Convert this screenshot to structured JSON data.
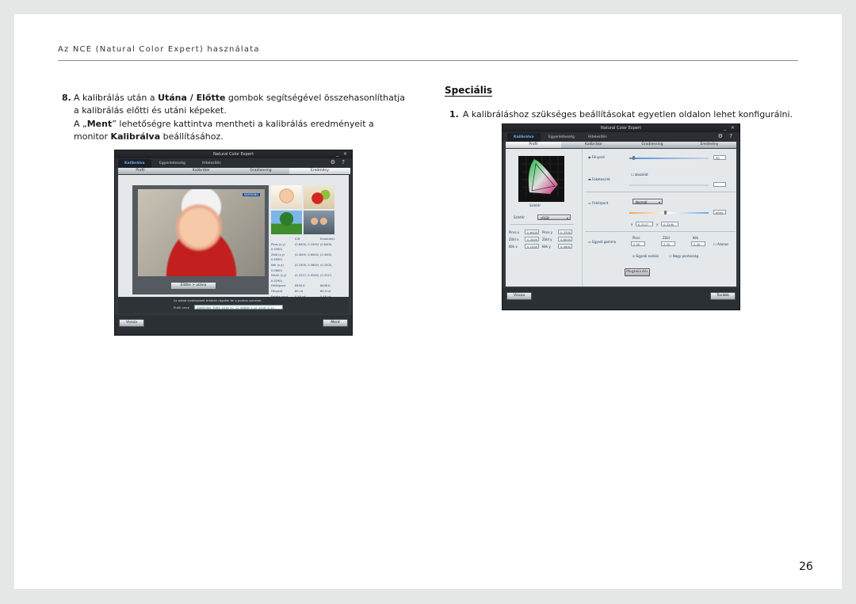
{
  "header": {
    "running_head": "Az NCE (Natural Color Expert) használata",
    "page_number": "26"
  },
  "step8": {
    "number": "8.",
    "p1_a": "A kalibrálás után a ",
    "p1_b": "Utána / Előtte",
    "p1_c": " gombok segítségével összehasonlíthatja a kalibrálás előtti és utáni képeket.",
    "p2_a": "A „",
    "p2_b": "Ment",
    "p2_c": "” lehetőségre kattintva mentheti a kalibrálás eredményeit a monitor ",
    "p2_d": "Kalibrálva",
    "p2_e": " beállításához."
  },
  "special": {
    "title": "Speciális",
    "step_number": "1.",
    "step_text": "A kalibráláshoz szükséges beállításokat egyetlen oldalon lehet konfigurálni."
  },
  "left_window": {
    "title": "Natural Color Expert",
    "controls": "_ ×",
    "tabs": [
      "Kalibrálva",
      "Egyenletesség",
      "Hitelesítés"
    ],
    "toolicons": "⚙ ?",
    "steps": [
      "Profil",
      "Kalibrátor",
      "Gradiensing",
      "Eredmény"
    ],
    "brand": "SAMSUNG",
    "toggle_btn": "Előtte  >  utána",
    "stats_header": [
      "ICB",
      "Eredmény"
    ],
    "stats_rows": [
      [
        "Piros (x,y)",
        "(0.6400, 0.3300)",
        "(0.6400, 0.3300)"
      ],
      [
        "Zöld (x,y)",
        "(0.3000, 0.6000)",
        "(0.3000, 0.6000)"
      ],
      [
        "Kék (x,y)",
        "(0.1500, 0.0600)",
        "(0.1500, 0.0600)"
      ],
      [
        "Fehér (x,y)",
        "(0.3127, 0.3290)",
        "(0.3127, 0.3290)"
      ],
      [
        "Fehérpont",
        "6504 K",
        "6498 K"
      ],
      [
        "Fényerő",
        "80 cd",
        "80.0 cd"
      ],
      [
        "Fekete pont",
        "0.50 cd",
        "0.48 cd"
      ],
      [
        "Értékek gamma",
        "2.20",
        "2.20"
      ]
    ],
    "notice": "Az alább kiválasztott értékek rögzítik fel a pontos színeket.",
    "profile_label": "Profil neve",
    "profile_value": "SAMSUNG_TDBS_2016_07_12_64836_1.12_2016_3_25",
    "back_btn": "Vissza",
    "save_btn": "Ment"
  },
  "right_window": {
    "title": "Natural Color Expert",
    "controls": "_ ×",
    "tabs": [
      "Kalibrálva",
      "Egyenletesség",
      "Hitelesítés"
    ],
    "toolicons": "⚙ ?",
    "steps": [
      "Profil",
      "Kalibrátor",
      "Gradiensing",
      "Eredmény"
    ],
    "brightness_label": "Fényerő",
    "brightness_value": "90",
    "blacklevel_label": "Feketeszint",
    "blacklevel_check": "abszolút",
    "whitepoint_label": "Fehérpont",
    "whitepoint_select": "Normál",
    "whitepoint_value": "6504",
    "white_x": "0.3127",
    "white_y": "0.3290",
    "gamut_select": "sRGB",
    "gamut_label": "Színtér",
    "gamut_caption": "Színtér",
    "primaries": [
      [
        "Piros x",
        "0.6400",
        "Piros y",
        "0.3300"
      ],
      [
        "Zöld x",
        "0.3000",
        "Zöld y",
        "0.6000"
      ],
      [
        "Kék x",
        "0.1500",
        "Kék y",
        "0.0600"
      ]
    ],
    "gamma_label": "Egyedi gamma",
    "gamma_cols": [
      "Piros",
      "Zöld",
      "Kék"
    ],
    "gamma_values": [
      "2.20",
      "2.20",
      "2.20"
    ],
    "gamma_check": "Azonos",
    "check_a": "Egyedi eszköz",
    "check_b": "Nagy pontosság",
    "apply_btn": "Megtekintés",
    "back_btn": "Vissza",
    "next_btn": "Tovább",
    "colors": {
      "accent": "#6fb0ff",
      "chrome": "#34393f"
    }
  }
}
